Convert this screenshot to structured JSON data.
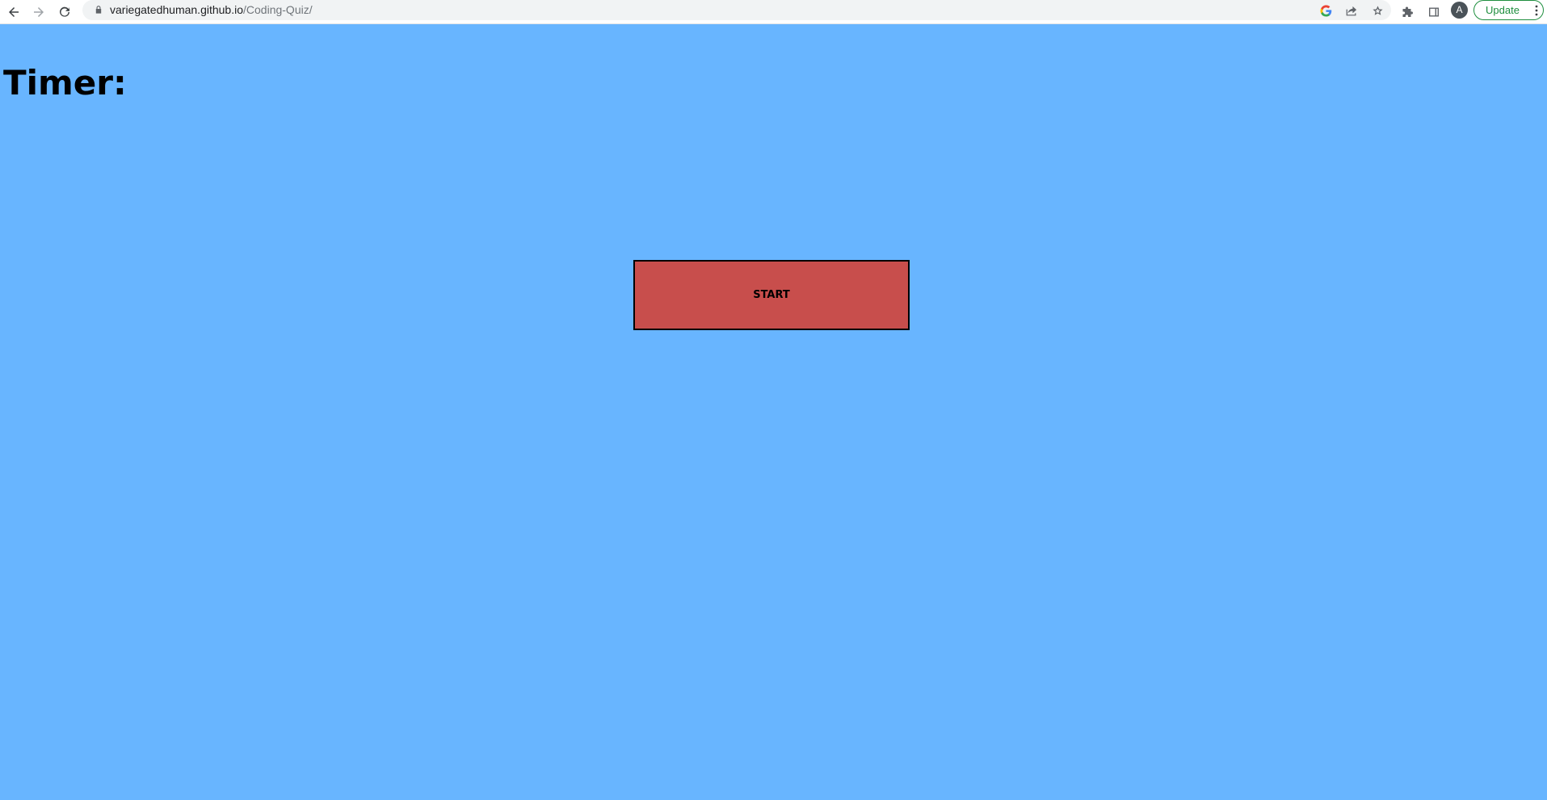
{
  "browser": {
    "url_host": "variegatedhuman.github.io",
    "url_path": "/Coding-Quiz/",
    "profile_initial": "A",
    "update_label": "Update",
    "icons": [
      "back-arrow-icon",
      "forward-arrow-icon",
      "reload-icon",
      "lock-icon",
      "google-icon",
      "share-icon",
      "bookmark-star-icon",
      "extensions-puzzle-icon",
      "side-panel-icon",
      "kebab-menu-icon"
    ]
  },
  "page": {
    "timer_label": "Timer:",
    "start_label": "START",
    "colors": {
      "background": "#68b5ff",
      "start_button": "#c84e4c",
      "text": "#000000"
    }
  }
}
